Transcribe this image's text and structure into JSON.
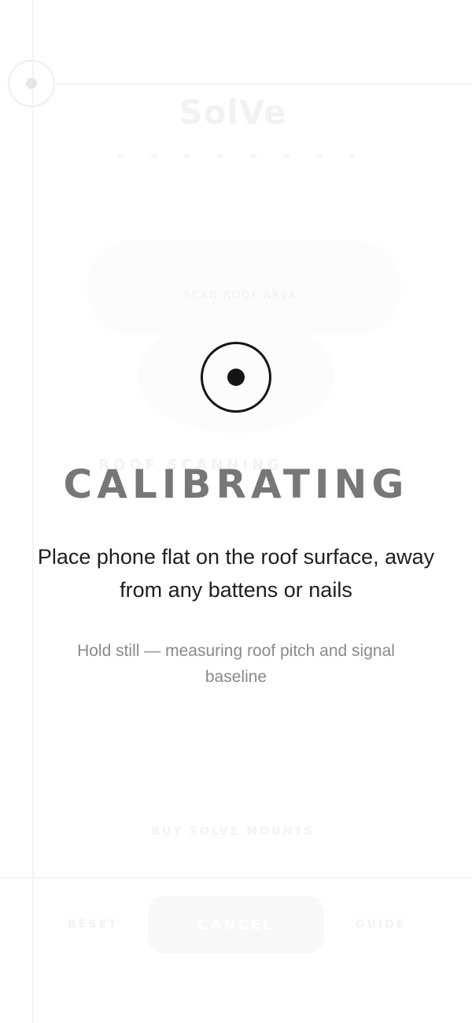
{
  "background": {
    "logo": "SolVe",
    "small_label": "SCAN ROOF AREA",
    "scan_title": "ROOF SCANNING",
    "buy_label": "BUY SOLVE MOUNTS",
    "footer": {
      "reset_label": "RESET",
      "cancel_label": "CANCEL",
      "guide_label": "GUIDE"
    }
  },
  "calibration": {
    "icon": "target-icon",
    "title": "CALIBRATING",
    "instruction": "Place phone flat on the roof surface, away from any battens or nails",
    "hint": "Hold still — measuring roof pitch and signal baseline"
  }
}
